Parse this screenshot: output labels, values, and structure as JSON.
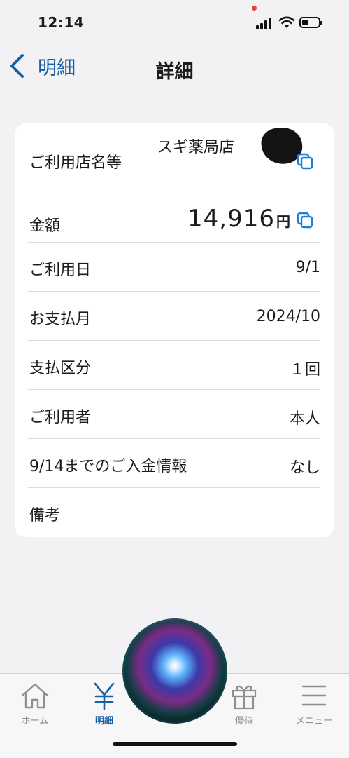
{
  "status_bar": {
    "time": "12:14"
  },
  "nav": {
    "back_label": "明細",
    "title": "詳細"
  },
  "details": {
    "store": {
      "label": "ご利用店名等",
      "value": "スギ薬局店"
    },
    "amount": {
      "label": "金額",
      "value": "14,916",
      "unit": "円"
    },
    "use_date": {
      "label": "ご利用日",
      "value": "9/1"
    },
    "pay_month": {
      "label": "お支払月",
      "value": "2024/10"
    },
    "pay_type": {
      "label": "支払区分",
      "value": "１回"
    },
    "user": {
      "label": "ご利用者",
      "value": "本人"
    },
    "deposit_info": {
      "label": "9/14までのご入金情報",
      "value": "なし"
    },
    "remarks": {
      "label": "備考",
      "value": ""
    }
  },
  "tabs": [
    {
      "label": "ホーム",
      "icon": "home-icon"
    },
    {
      "label": "明細",
      "icon": "yen-icon",
      "active": true
    },
    {
      "label": "優待",
      "icon": "gift-icon"
    },
    {
      "label": "メニュー",
      "icon": "menu-icon"
    }
  ],
  "colors": {
    "accent": "#1a5fa6",
    "background": "#f2f2f4",
    "card": "#ffffff"
  }
}
